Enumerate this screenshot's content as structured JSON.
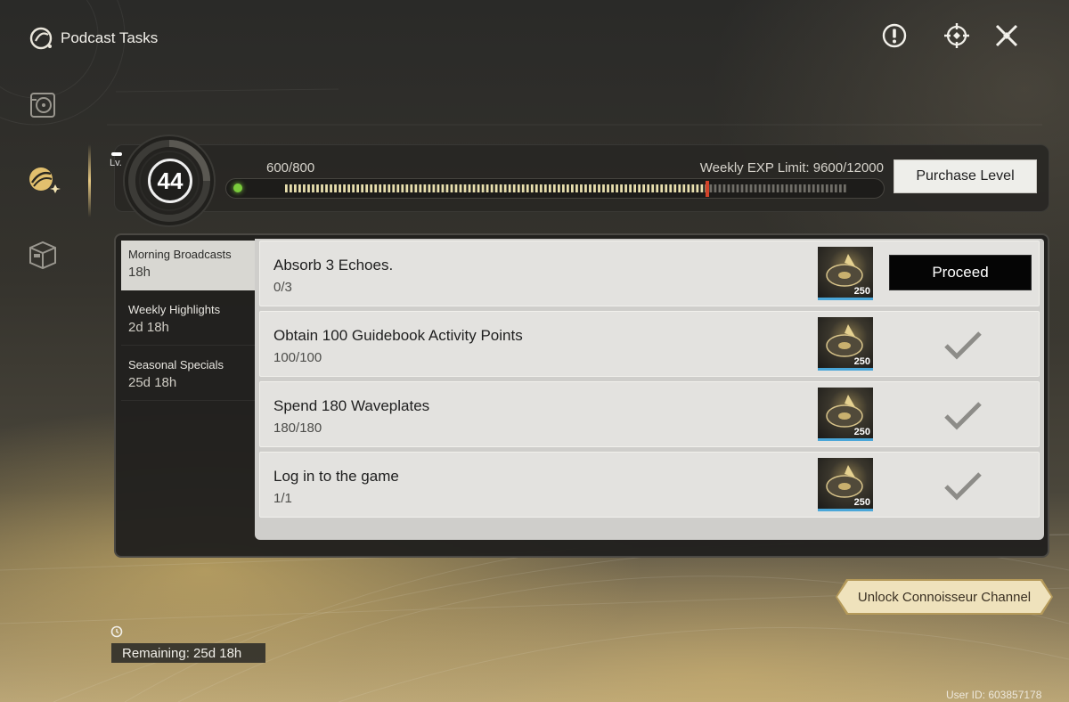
{
  "app": {
    "title": "Podcast Tasks"
  },
  "top_icons": [
    "info-icon",
    "crosshair-icon",
    "close-icon"
  ],
  "sidebar": {
    "items": [
      {
        "name": "vinyl-icon",
        "active": false
      },
      {
        "name": "podcast-icon",
        "active": true
      },
      {
        "name": "box-icon",
        "active": false
      }
    ]
  },
  "level": {
    "tag": "Lv.",
    "value": "44",
    "exp_text": "600/800",
    "weekly_limit_text": "Weekly EXP Limit: 9600/12000",
    "exp_fraction": 0.75,
    "purchase_label": "Purchase Level"
  },
  "categories": [
    {
      "title": "Morning Broadcasts",
      "time": "18h"
    },
    {
      "title": "Weekly Highlights",
      "time": "2d 18h"
    },
    {
      "title": "Seasonal Specials",
      "time": "25d 18h"
    }
  ],
  "tasks": [
    {
      "title": "Absorb 3 Echoes.",
      "progress": "0/3",
      "reward": "250",
      "action": "Proceed"
    },
    {
      "title": "Obtain 100 Guidebook Activity Points",
      "progress": "100/100",
      "reward": "250"
    },
    {
      "title": "Spend 180 Waveplates",
      "progress": "180/180",
      "reward": "250"
    },
    {
      "title": "Log in to the game",
      "progress": "1/1",
      "reward": "250"
    }
  ],
  "footer": {
    "unlock_label": "Unlock Connoisseur Channel",
    "remaining": "Remaining: 25d 18h",
    "user_id": "User ID: 603857178"
  },
  "colors": {
    "accent_gold": "#e6c882",
    "exp_marker": "#d2442a",
    "exp_dot": "#7acb3c",
    "reward_underline": "#4aa6d8"
  }
}
